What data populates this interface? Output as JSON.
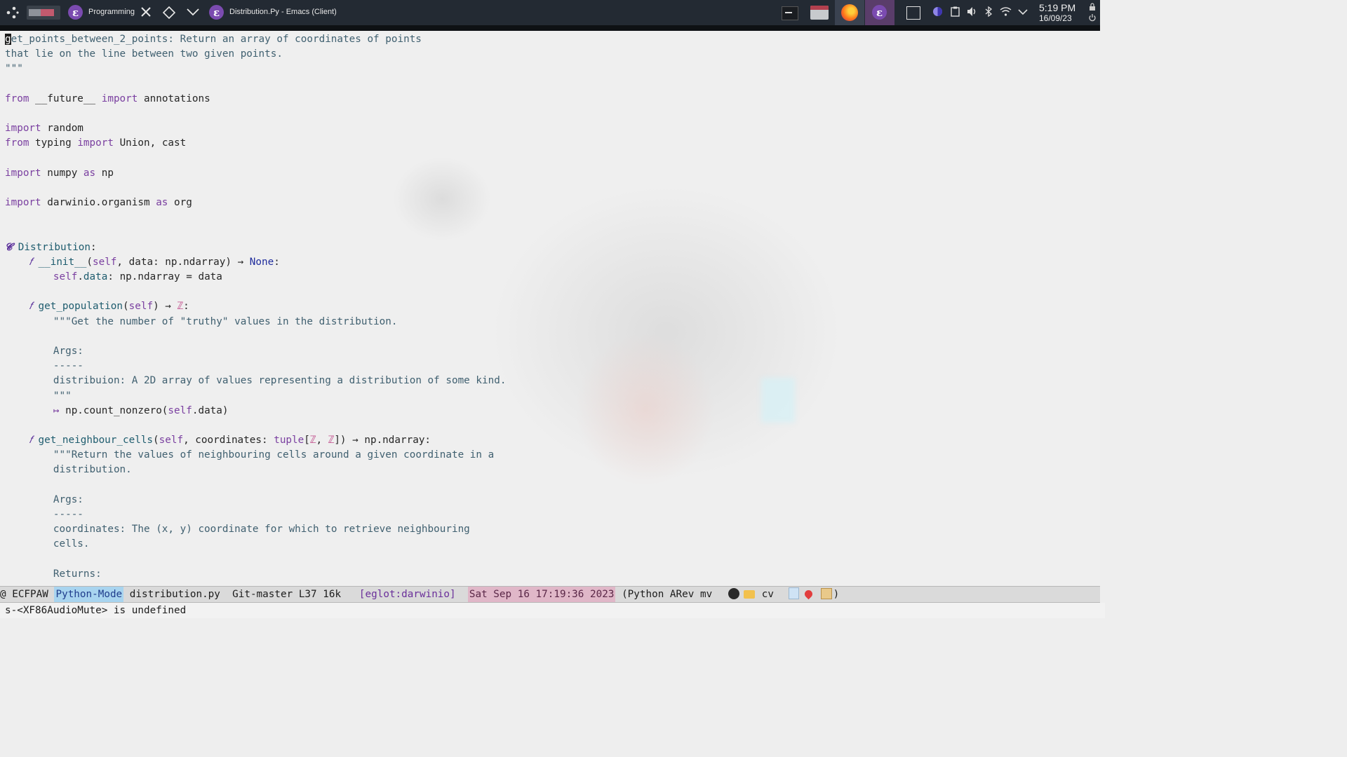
{
  "taskbar": {
    "workspace_label": "Programming",
    "window_title": "Distribution.Py - Emacs (Client)",
    "clock_time": "5:19 PM",
    "clock_date": "16/09/23"
  },
  "code_lines": [
    [
      {
        "t": "g",
        "c": "cursor-char"
      },
      {
        "t": "et_points_between_2_points: Return an array of coordinates of points",
        "c": "str"
      }
    ],
    [
      {
        "t": "that lie on the line between two given points.",
        "c": "str"
      }
    ],
    [
      {
        "t": "\"\"\"",
        "c": "str"
      }
    ],
    [],
    [
      {
        "t": "from",
        "c": "kw"
      },
      {
        "t": " __future__ "
      },
      {
        "t": "import",
        "c": "kw"
      },
      {
        "t": " annotations"
      }
    ],
    [],
    [
      {
        "t": "import",
        "c": "kw"
      },
      {
        "t": " random"
      }
    ],
    [
      {
        "t": "from",
        "c": "kw"
      },
      {
        "t": " typing "
      },
      {
        "t": "import",
        "c": "kw"
      },
      {
        "t": " Union, cast"
      }
    ],
    [],
    [
      {
        "t": "import",
        "c": "kw"
      },
      {
        "t": " numpy "
      },
      {
        "t": "as",
        "c": "kw"
      },
      {
        "t": " np"
      }
    ],
    [],
    [
      {
        "t": "import",
        "c": "kw"
      },
      {
        "t": " darwinio.organism "
      },
      {
        "t": "as",
        "c": "kw"
      },
      {
        "t": " org"
      }
    ],
    [],
    [],
    [
      {
        "t": "𝓒",
        "c": "sym-c"
      },
      {
        "t": " "
      },
      {
        "t": "Distribution",
        "c": "cls"
      },
      {
        "t": ":"
      }
    ],
    [
      {
        "t": "    "
      },
      {
        "t": "𝑓",
        "c": "sym-f"
      },
      {
        "t": " "
      },
      {
        "t": "__init__",
        "c": "fn"
      },
      {
        "t": "("
      },
      {
        "t": "self",
        "c": "self"
      },
      {
        "t": ", data: np.ndarray) → "
      },
      {
        "t": "None",
        "c": "const"
      },
      {
        "t": ":"
      }
    ],
    [
      {
        "t": "        "
      },
      {
        "t": "self",
        "c": "self"
      },
      {
        "t": "."
      },
      {
        "t": "data",
        "c": "fn"
      },
      {
        "t": ": np.ndarray = data"
      }
    ],
    [],
    [
      {
        "t": "    "
      },
      {
        "t": "𝑓",
        "c": "sym-f"
      },
      {
        "t": " "
      },
      {
        "t": "get_population",
        "c": "fn"
      },
      {
        "t": "("
      },
      {
        "t": "self",
        "c": "self"
      },
      {
        "t": ") → "
      },
      {
        "t": "ℤ",
        "c": "num"
      },
      {
        "t": ":"
      }
    ],
    [
      {
        "t": "        "
      },
      {
        "t": "\"\"\"Get the number of \"truthy\" values in the distribution.",
        "c": "str"
      }
    ],
    [],
    [
      {
        "t": "        "
      },
      {
        "t": "Args:",
        "c": "str"
      }
    ],
    [
      {
        "t": "        "
      },
      {
        "t": "-----",
        "c": "str"
      }
    ],
    [
      {
        "t": "        "
      },
      {
        "t": "distribuion: A 2D array of values representing a distribution of some kind.",
        "c": "str"
      }
    ],
    [
      {
        "t": "        "
      },
      {
        "t": "\"\"\"",
        "c": "str"
      }
    ],
    [
      {
        "t": "        "
      },
      {
        "t": "↦",
        "c": "kw"
      },
      {
        "t": " np.count_nonzero("
      },
      {
        "t": "self",
        "c": "self"
      },
      {
        "t": ".data)"
      }
    ],
    [],
    [
      {
        "t": "    "
      },
      {
        "t": "𝑓",
        "c": "sym-f"
      },
      {
        "t": " "
      },
      {
        "t": "get_neighbour_cells",
        "c": "fn"
      },
      {
        "t": "("
      },
      {
        "t": "self",
        "c": "self"
      },
      {
        "t": ", coordinates: "
      },
      {
        "t": "tuple",
        "c": "kw"
      },
      {
        "t": "["
      },
      {
        "t": "ℤ",
        "c": "num"
      },
      {
        "t": ", "
      },
      {
        "t": "ℤ",
        "c": "num"
      },
      {
        "t": "]) → np.ndarray:"
      }
    ],
    [
      {
        "t": "        "
      },
      {
        "t": "\"\"\"Return the values of neighbouring cells around a given coordinate in a",
        "c": "str"
      }
    ],
    [
      {
        "t": "        "
      },
      {
        "t": "distribution.",
        "c": "str"
      }
    ],
    [],
    [
      {
        "t": "        "
      },
      {
        "t": "Args:",
        "c": "str"
      }
    ],
    [
      {
        "t": "        "
      },
      {
        "t": "-----",
        "c": "str"
      }
    ],
    [
      {
        "t": "        "
      },
      {
        "t": "coordinates: The (x, y) coordinate for which to retrieve neighbouring",
        "c": "str"
      }
    ],
    [
      {
        "t": "        "
      },
      {
        "t": "cells.",
        "c": "str"
      }
    ],
    [],
    [
      {
        "t": "        "
      },
      {
        "t": "Returns:",
        "c": "str"
      }
    ]
  ],
  "modeline": {
    "at": "@",
    "flags": "ECFPAW",
    "mode": "Python-Mode",
    "buffer": "distribution.py",
    "vc": "Git-master",
    "line": "L37",
    "size": "16k",
    "eglot": "[eglot:darwinio]",
    "datetime": "Sat Sep 16 17:19:36 2023",
    "minor_modes": "(Python ARev mv",
    "tail": "cv",
    "close_paren": ")"
  },
  "echo_area": "s-<XF86AudioMute> is undefined",
  "colors": {
    "panel_bg": "#232a33",
    "editor_bg": "#efefef",
    "keyword": "#7a3fa0",
    "docstring": "#406070",
    "mode_highlight": "#a8d4ef",
    "date_highlight": "#e0b7c8"
  }
}
